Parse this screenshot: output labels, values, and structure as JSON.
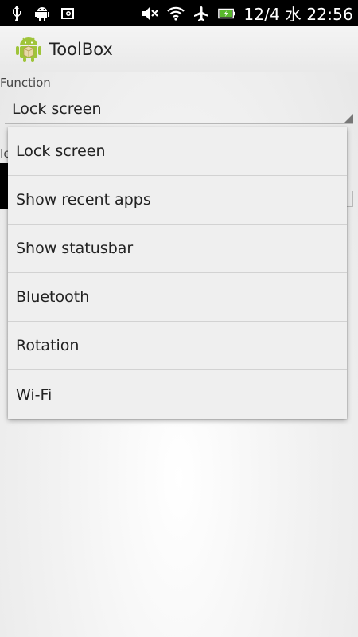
{
  "status_bar": {
    "time": "12/4 水 22:56",
    "icons_left": [
      "usb-icon",
      "android-debug-icon",
      "screenshot-icon"
    ],
    "icons_right": [
      "mute-icon",
      "wifi-icon",
      "airplane-icon",
      "battery-charging-icon"
    ]
  },
  "action_bar": {
    "title": "ToolBox",
    "icon": "android-app-icon"
  },
  "form": {
    "function_label": "Function",
    "function_value": "Lock screen",
    "second_label_partial": "Ic"
  },
  "dropdown": {
    "options": [
      {
        "label": "Lock screen"
      },
      {
        "label": "Show recent apps"
      },
      {
        "label": "Show statusbar"
      },
      {
        "label": "Bluetooth"
      },
      {
        "label": "Rotation"
      },
      {
        "label": "Wi-Fi"
      }
    ]
  }
}
